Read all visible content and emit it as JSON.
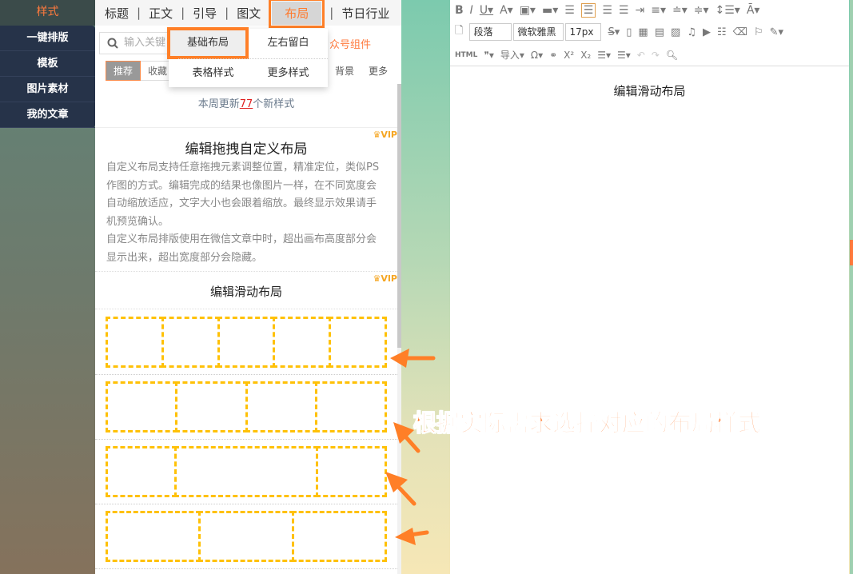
{
  "sidebar": {
    "active": "样式",
    "items": [
      "一键排版",
      "模板",
      "图片素材",
      "我的文章"
    ]
  },
  "tabs": [
    "标题",
    "正文",
    "引导",
    "图文",
    "布局",
    "节日行业"
  ],
  "dropdown": [
    "基础布局",
    "左右留白",
    "表格样式",
    "更多样式"
  ],
  "search": {
    "placeholder": "输入关键"
  },
  "gzh": "众号组件",
  "filters": {
    "rec": "推荐",
    "coll": "收藏",
    "bg": "背景",
    "more": "更多"
  },
  "update": {
    "pre": "本周更新",
    "num": "77",
    "post": "个新样式"
  },
  "card1": {
    "vip": "VIP",
    "title": "编辑拖拽自定义布局",
    "desc": "自定义布局支持任意拖拽元素调整位置，精准定位，类似PS作图的方式。编辑完成的结果也像图片一样，在不同宽度会自动缩放适应，文字大小也会跟着缩放。最终显示效果请手机预览确认。",
    "desc2": "自定义布局排版使用在微信文章中时，超出画布高度部分会显示出来，超出宽度部分会隐藏。"
  },
  "card2": {
    "vip": "VIP",
    "title": "编辑滑动布局"
  },
  "editor": {
    "para": "段落",
    "font": "微软雅黑",
    "size": "17px",
    "html": "HTML",
    "import": "导入",
    "content": "编辑滑动布局"
  },
  "callout": "根据实际需求选择对应的布局样式",
  "colors": {
    "accent": "#ff7f27",
    "dash": "#ffc107",
    "nav": "#263349"
  }
}
